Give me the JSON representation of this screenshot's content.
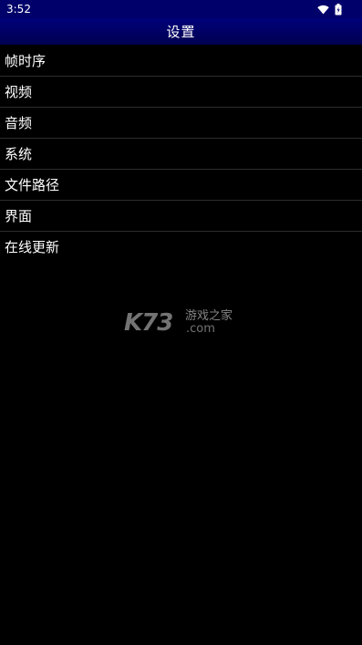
{
  "status_bar": {
    "time": "3:52",
    "icons": [
      "wifi-icon",
      "battery-icon"
    ]
  },
  "app_bar": {
    "title": "设置"
  },
  "menu": {
    "items": [
      {
        "label": "帧时序"
      },
      {
        "label": "视频"
      },
      {
        "label": "音频"
      },
      {
        "label": "系统"
      },
      {
        "label": "文件路径"
      },
      {
        "label": "界面"
      },
      {
        "label": "在线更新"
      }
    ]
  },
  "watermark": {
    "brand": "K73",
    "tagline": "游戏之家",
    "domain": ".com"
  },
  "colors": {
    "background": "#000000",
    "header": "#00006b",
    "divider": "#2e2e2e",
    "text": "#ffffff"
  }
}
